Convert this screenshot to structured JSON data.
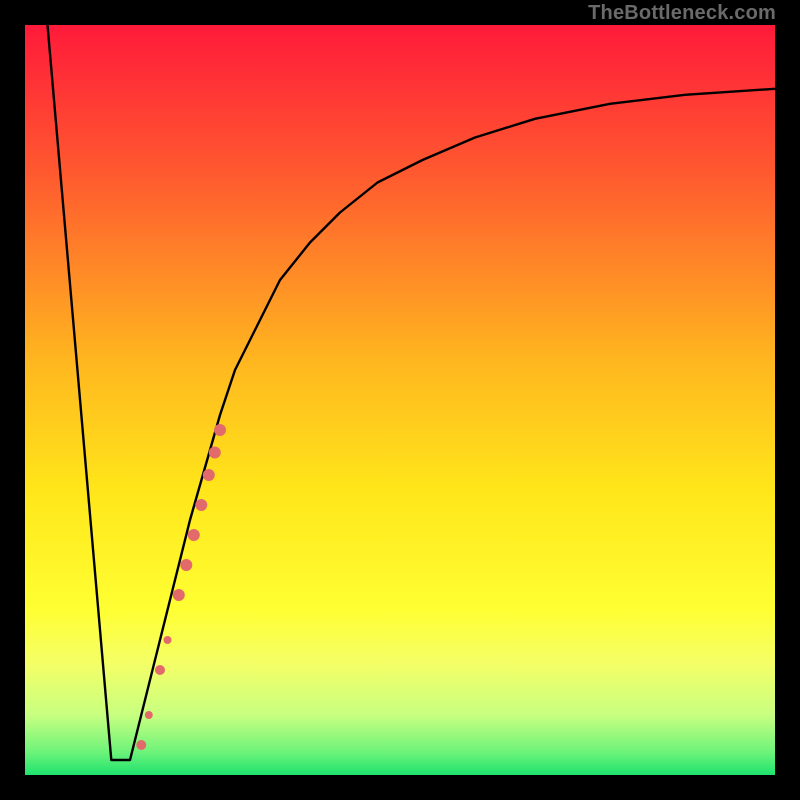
{
  "watermark": "TheBottleneck.com",
  "chart_data": {
    "type": "line",
    "title": "",
    "xlabel": "",
    "ylabel": "",
    "xlim": [
      0,
      100
    ],
    "ylim": [
      0,
      100
    ],
    "grid": false,
    "legend": false,
    "gradient_stops": [
      {
        "offset": 0,
        "color": "#ff1a3a"
      },
      {
        "offset": 20,
        "color": "#ff5a2f"
      },
      {
        "offset": 45,
        "color": "#ffb71f"
      },
      {
        "offset": 62,
        "color": "#ffe61a"
      },
      {
        "offset": 78,
        "color": "#ffff33"
      },
      {
        "offset": 85,
        "color": "#f5ff66"
      },
      {
        "offset": 92,
        "color": "#c8ff80"
      },
      {
        "offset": 97,
        "color": "#6cf37a"
      },
      {
        "offset": 100,
        "color": "#1de36e"
      }
    ],
    "series": [
      {
        "name": "left-slope",
        "x": [
          3,
          11.5
        ],
        "values": [
          100,
          2
        ]
      },
      {
        "name": "floor",
        "x": [
          11.5,
          14
        ],
        "values": [
          2,
          2
        ]
      },
      {
        "name": "right-curve",
        "x": [
          14,
          16,
          18,
          20,
          22,
          24,
          26,
          28,
          31,
          34,
          38,
          42,
          47,
          53,
          60,
          68,
          78,
          88,
          100
        ],
        "values": [
          2,
          10,
          18,
          26,
          34,
          41,
          48,
          54,
          60,
          66,
          71,
          75,
          79,
          82,
          85,
          87.5,
          89.5,
          90.7,
          91.5
        ]
      }
    ],
    "markers": {
      "name": "highlight-points",
      "color": "#e36a6a",
      "points": [
        {
          "x": 15.5,
          "y": 4,
          "r": 5
        },
        {
          "x": 16.5,
          "y": 8,
          "r": 4
        },
        {
          "x": 18.0,
          "y": 14,
          "r": 5
        },
        {
          "x": 19.0,
          "y": 18,
          "r": 4
        },
        {
          "x": 20.5,
          "y": 24,
          "r": 6
        },
        {
          "x": 21.5,
          "y": 28,
          "r": 6
        },
        {
          "x": 22.5,
          "y": 32,
          "r": 6
        },
        {
          "x": 23.5,
          "y": 36,
          "r": 6
        },
        {
          "x": 24.5,
          "y": 40,
          "r": 6
        },
        {
          "x": 25.3,
          "y": 43,
          "r": 6
        },
        {
          "x": 26.0,
          "y": 46,
          "r": 6
        }
      ]
    }
  }
}
